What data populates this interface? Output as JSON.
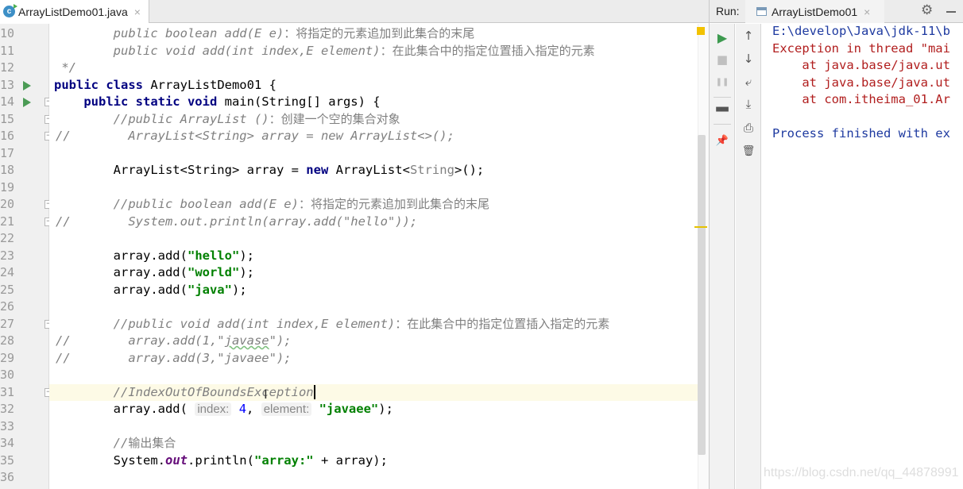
{
  "editor": {
    "tab_label": "ArrayListDemo01.java",
    "tab_close": "×",
    "lines": [
      {
        "num": "10",
        "segments": [
          {
            "t": "        public boolean add(E e)",
            "c": "cm"
          },
          {
            "t": "：将指定的元素追加到此集合的末尾",
            "c": "cmcn"
          }
        ]
      },
      {
        "num": "11",
        "segments": [
          {
            "t": "        public void add(int index,E element)",
            "c": "cm"
          },
          {
            "t": "：在此集合中的指定位置插入指定的元素",
            "c": "cmcn"
          }
        ]
      },
      {
        "num": "12",
        "segments": [
          {
            "t": " */",
            "c": "cm"
          }
        ]
      },
      {
        "num": "13",
        "segments": [
          {
            "t": "public class ",
            "c": "kw"
          },
          {
            "t": "ArrayListDemo01 {",
            "c": ""
          }
        ]
      },
      {
        "num": "14",
        "segments": [
          {
            "t": "    public static void ",
            "c": "kw"
          },
          {
            "t": "main(String[] args) {",
            "c": ""
          }
        ]
      },
      {
        "num": "15",
        "segments": [
          {
            "t": "        //public ArrayList ()",
            "c": "cm"
          },
          {
            "t": "：创建一个空的集合对象",
            "c": "cmcn"
          }
        ]
      },
      {
        "num": "16",
        "segments": [
          {
            "t": "          ArrayList<String> array = new ArrayList<>();",
            "c": "cm"
          }
        ]
      },
      {
        "num": "17",
        "segments": []
      },
      {
        "num": "18",
        "segments": [
          {
            "t": "        ArrayList<String> array = ",
            "c": ""
          },
          {
            "t": "new ",
            "c": "kw"
          },
          {
            "t": "ArrayList<",
            "c": ""
          },
          {
            "t": "String",
            "c": "gen"
          },
          {
            "t": ">();",
            "c": ""
          }
        ]
      },
      {
        "num": "19",
        "segments": []
      },
      {
        "num": "20",
        "segments": [
          {
            "t": "        //public boolean add(E e)",
            "c": "cm"
          },
          {
            "t": "：将指定的元素追加到此集合的末尾",
            "c": "cmcn"
          }
        ]
      },
      {
        "num": "21",
        "segments": [
          {
            "t": "          System.out.println(array.add(\"hello\"));",
            "c": "cm"
          }
        ]
      },
      {
        "num": "22",
        "segments": []
      },
      {
        "num": "23",
        "segments": [
          {
            "t": "        array.add(",
            "c": ""
          },
          {
            "t": "\"hello\"",
            "c": "str"
          },
          {
            "t": ");",
            "c": ""
          }
        ]
      },
      {
        "num": "24",
        "segments": [
          {
            "t": "        array.add(",
            "c": ""
          },
          {
            "t": "\"world\"",
            "c": "str"
          },
          {
            "t": ");",
            "c": ""
          }
        ]
      },
      {
        "num": "25",
        "segments": [
          {
            "t": "        array.add(",
            "c": ""
          },
          {
            "t": "\"java\"",
            "c": "str"
          },
          {
            "t": ");",
            "c": ""
          }
        ]
      },
      {
        "num": "26",
        "segments": []
      },
      {
        "num": "27",
        "segments": [
          {
            "t": "        //public void add(int index,E element)",
            "c": "cm"
          },
          {
            "t": "：在此集合中的指定位置插入指定的元素",
            "c": "cmcn"
          }
        ]
      },
      {
        "num": "28",
        "segments": [
          {
            "t": "          array.add(1,\"",
            "c": "cm"
          },
          {
            "t": "javase",
            "c": "cm squiggle"
          },
          {
            "t": "\");",
            "c": "cm"
          }
        ]
      },
      {
        "num": "29",
        "segments": [
          {
            "t": "          array.add(3,\"javaee\");",
            "c": "cm"
          }
        ]
      },
      {
        "num": "30",
        "segments": []
      },
      {
        "num": "31",
        "segments": [
          {
            "t": "        //IndexOutOfBoundsException",
            "c": "cm"
          }
        ]
      },
      {
        "num": "32",
        "segments": [
          {
            "t": "        array.add( ",
            "c": ""
          },
          {
            "t": "index:",
            "c": "hint"
          },
          {
            "t": " ",
            "c": ""
          },
          {
            "t": "4",
            "c": "num"
          },
          {
            "t": ", ",
            "c": ""
          },
          {
            "t": "element:",
            "c": "hint"
          },
          {
            "t": " ",
            "c": ""
          },
          {
            "t": "\"javaee\"",
            "c": "str"
          },
          {
            "t": ");",
            "c": ""
          }
        ]
      },
      {
        "num": "33",
        "segments": []
      },
      {
        "num": "34",
        "segments": [
          {
            "t": "        //",
            "c": "cm"
          },
          {
            "t": "输出集合",
            "c": "cmcn"
          }
        ]
      },
      {
        "num": "35",
        "segments": [
          {
            "t": "        System.",
            "c": ""
          },
          {
            "t": "out",
            "c": "fld"
          },
          {
            "t": ".println(",
            "c": ""
          },
          {
            "t": "\"array:\"",
            "c": "str"
          },
          {
            "t": " + array);",
            "c": ""
          }
        ]
      },
      {
        "num": "36",
        "segments": []
      }
    ],
    "gutter_comment_marker": "//"
  },
  "run": {
    "label": "Run:",
    "tab_label": "ArrayListDemo01",
    "tab_close": "×",
    "toolbar1": [
      {
        "name": "rerun-icon",
        "glyph": "▶"
      },
      {
        "name": "stop-icon",
        "glyph": "■"
      },
      {
        "name": "pause-icon",
        "glyph": "❚❚"
      },
      {
        "name": "layout-icon",
        "glyph": "▀▀"
      },
      {
        "name": "pin-icon",
        "glyph": "📌"
      }
    ],
    "toolbar2": [
      {
        "name": "up-arrow-icon",
        "glyph": "↑"
      },
      {
        "name": "down-arrow-icon",
        "glyph": "↓"
      },
      {
        "name": "soft-wrap-icon",
        "glyph": "⤶"
      },
      {
        "name": "scroll-to-end-icon",
        "glyph": "⤓"
      },
      {
        "name": "print-icon",
        "glyph": "⎙"
      },
      {
        "name": "trash-icon",
        "glyph": "🗑"
      }
    ],
    "console": [
      {
        "text": "E:\\develop\\Java\\jdk-11\\b",
        "kind": "blue"
      },
      {
        "text": "Exception in thread \"mai",
        "kind": "red"
      },
      {
        "text": "    at java.base/java.ut",
        "kind": "trace"
      },
      {
        "text": "    at java.base/java.ut",
        "kind": "trace"
      },
      {
        "text": "    at com.itheima_01.Ar",
        "kind": "trace"
      },
      {
        "text": "",
        "kind": "blue"
      },
      {
        "text": "Process finished with ex",
        "kind": "blue"
      }
    ]
  },
  "watermark": "https://blog.csdn.net/qq_44878991"
}
